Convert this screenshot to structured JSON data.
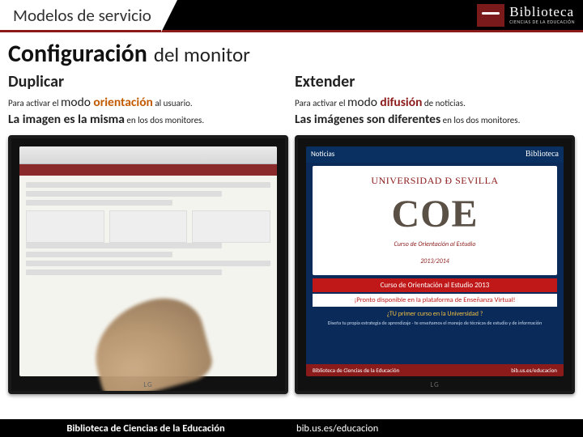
{
  "header": {
    "title": "Modelos de servicio",
    "logo_text": "Biblioteca",
    "logo_sub": "CIENCIAS DE LA EDUCACIÓN"
  },
  "main_title": {
    "bold": "Configuración",
    "light": "del monitor"
  },
  "left": {
    "heading": "Duplicar",
    "pre1": "Para activar el ",
    "mode": "modo ",
    "mode_word": "orientación",
    "post1": " al usuario.",
    "line2a": "La imagen es la misma",
    "line2b": " en los dos monitores."
  },
  "right": {
    "heading": "Extender",
    "pre1": "Para activar el ",
    "mode": "modo ",
    "mode_word": "difusión",
    "post1": " de noticias.",
    "line2a": "Las imágenes son diferentes",
    "line2b": " en los dos monitores."
  },
  "screen_right": {
    "noticias": "Noticias",
    "logo": "Biblioteca",
    "univ": "UNIVERSIDAD Đ SEVILLA",
    "coe": "COE",
    "coe_sub": "Curso de Orientación al Estudio",
    "year": "2013/2014",
    "red": "Curso de Orientación al Estudio 2013",
    "white": "¡Pronto disponible en la plataforma de Enseñanza Virtual!",
    "blue": "¿TU primer curso en la Universidad ?",
    "bluesub": "Diseña tu propia estrategia de aprendizaje - te enseñamos el manejo de técnicas de estudio y de información",
    "foot_left": "Biblioteca de Ciencias de la Educación",
    "foot_right": "bib.us.es/educacion"
  },
  "monitor_brand": "LG",
  "footer": {
    "left": "Biblioteca de Ciencias de la Educación",
    "right": "bib.us.es/educacion"
  }
}
